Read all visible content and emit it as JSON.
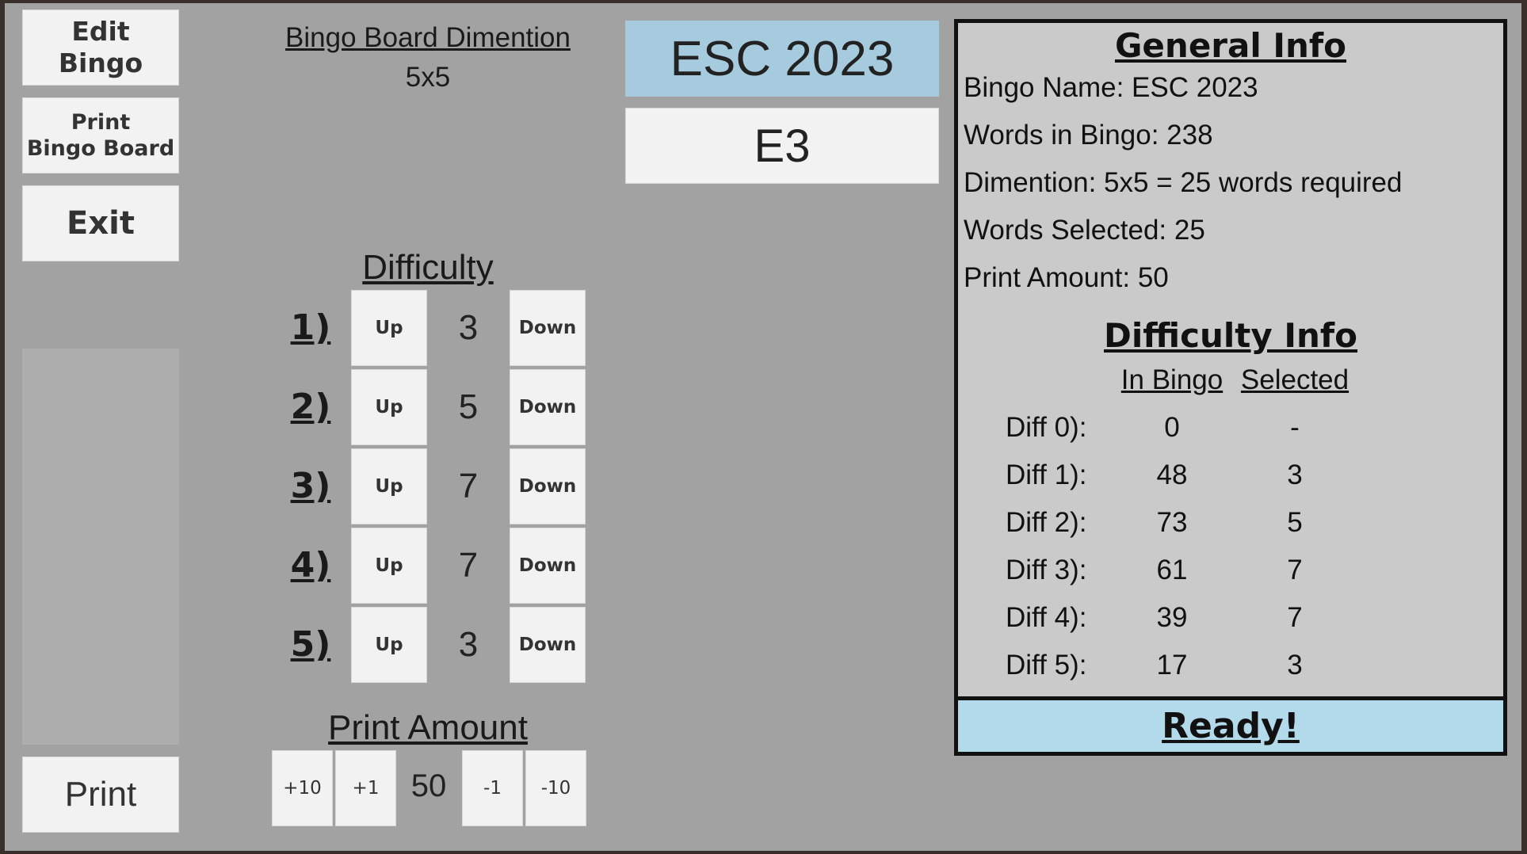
{
  "sidebar": {
    "edit_bingo": "Edit Bingo",
    "print_board_line1": "Print",
    "print_board_line2": "Bingo Board",
    "exit": "Exit",
    "print": "Print"
  },
  "board": {
    "label": "Bingo Board Dimention",
    "value": "5x5"
  },
  "header": {
    "bingo_name": "ESC 2023",
    "code": "E3"
  },
  "difficulty": {
    "title": "Difficulty",
    "up_label": "Up",
    "down_label": "Down",
    "rows": [
      {
        "label": "1)",
        "value": "3"
      },
      {
        "label": "2)",
        "value": "5"
      },
      {
        "label": "3)",
        "value": "7"
      },
      {
        "label": "4)",
        "value": "7"
      },
      {
        "label": "5)",
        "value": "3"
      }
    ]
  },
  "print_amount": {
    "title": "Print Amount",
    "plus10": "+10",
    "plus1": "+1",
    "value": "50",
    "minus1": "-1",
    "minus10": "-10"
  },
  "general_info": {
    "title": "General Info",
    "lines": [
      "Bingo Name: ESC 2023",
      "Words in Bingo: 238",
      "Dimention: 5x5 = 25 words required",
      "Words Selected: 25",
      "Print Amount: 50"
    ]
  },
  "difficulty_info": {
    "title": "Difficulty Info",
    "col_in_bingo": "In Bingo",
    "col_selected": "Selected",
    "rows": [
      {
        "label": "Diff 0):",
        "in_bingo": "0",
        "selected": "-"
      },
      {
        "label": "Diff 1):",
        "in_bingo": "48",
        "selected": "3"
      },
      {
        "label": "Diff 2):",
        "in_bingo": "73",
        "selected": "5"
      },
      {
        "label": "Diff 3):",
        "in_bingo": "61",
        "selected": "7"
      },
      {
        "label": "Diff 4):",
        "in_bingo": "39",
        "selected": "7"
      },
      {
        "label": "Diff 5):",
        "in_bingo": "17",
        "selected": "3"
      }
    ]
  },
  "status": {
    "text": "Ready!"
  },
  "colors": {
    "panel": "#a2a2a2",
    "button": "#f2f2f2",
    "name_button": "#a7cbde",
    "ready": "#b3daea"
  }
}
